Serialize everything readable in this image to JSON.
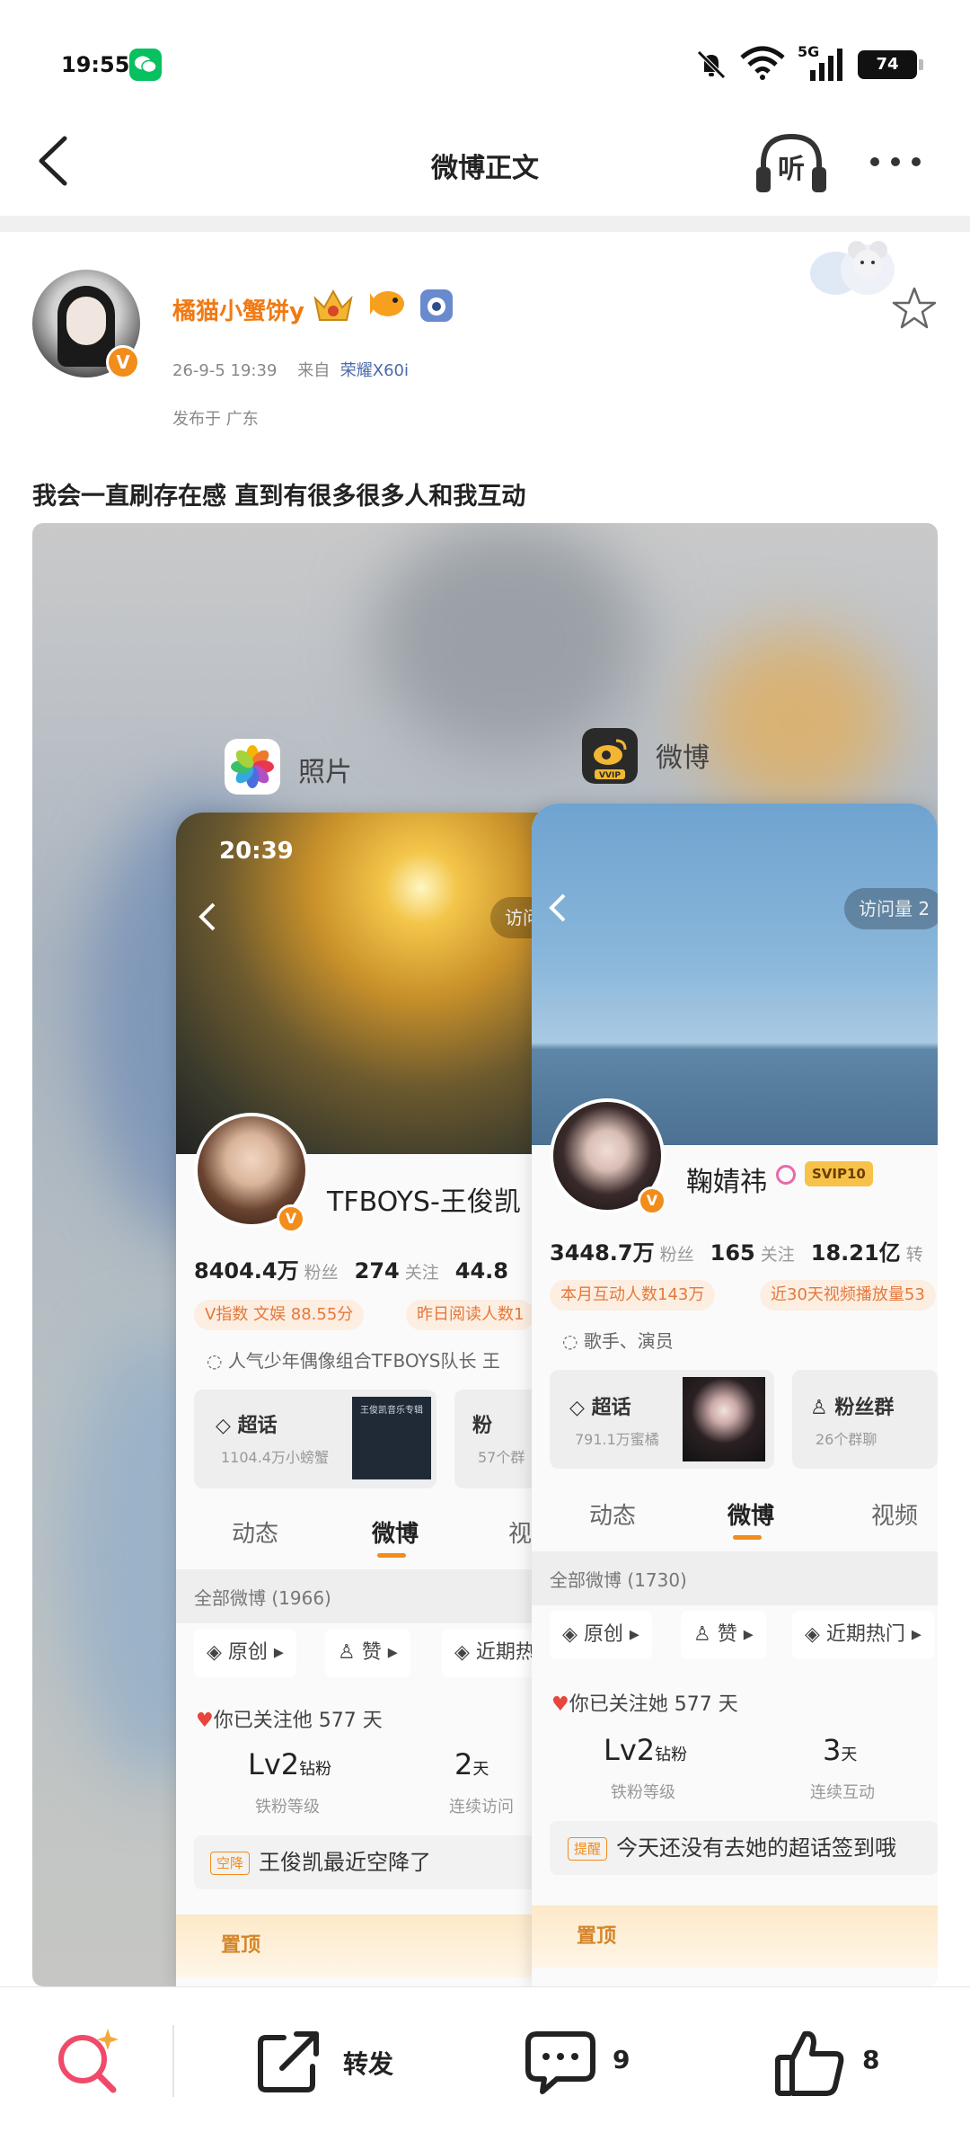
{
  "status_bar": {
    "time": "19:55",
    "network": "5G",
    "battery": "74"
  },
  "nav": {
    "title": "微博正文",
    "listen_label": "听"
  },
  "post": {
    "username": "橘猫小蟹饼y",
    "verified": "V",
    "timestamp": "26-9-5 19:39",
    "source_prefix": "来自",
    "device": "荣耀X60i",
    "location": "发布于 广东",
    "text": "我会一直刷存在感 直到有很多很多人和我互动"
  },
  "image": {
    "apps": [
      {
        "label": "照片"
      },
      {
        "label": "微博",
        "icon_badge": "VVIP"
      }
    ],
    "left_card": {
      "time": "20:39",
      "visit": "访问量",
      "name": "TFBOYS-王俊凯",
      "stats": [
        {
          "value": "8404.4万",
          "label": "粉丝"
        },
        {
          "value": "274",
          "label": "关注"
        },
        {
          "value": "44.8",
          "label": ""
        }
      ],
      "tags": [
        "V指数 文娱 88.55分",
        "昨日阅读人数1"
      ],
      "desc": "人气少年偶像组合TFBOYS队长 王",
      "box1_title": "超话",
      "box1_sub": "1104.4万小螃蟹",
      "box2_title": "粉",
      "box2_sub": "57个群",
      "album_caption": "王俊凯音乐专辑",
      "tabs": [
        "动态",
        "微博",
        "视"
      ],
      "all_count": "全部微博 (1966)",
      "filters": [
        "原创",
        "赞",
        "近期热"
      ],
      "follow": "你已关注他 577 天",
      "level_value": "Lv2",
      "level_unit": "钻粉",
      "level_label": "铁粉等级",
      "days_value": "2",
      "days_unit": "天",
      "days_label": "连续访问",
      "notice_tag": "空降",
      "notice": "王俊凯最近空降了",
      "pinned": "置顶"
    },
    "right_card": {
      "visit": "访问量 2",
      "name": "鞠婧祎",
      "svip": "SVIP10",
      "stats": [
        {
          "value": "3448.7万",
          "label": "粉丝"
        },
        {
          "value": "165",
          "label": "关注"
        },
        {
          "value": "18.21亿",
          "label": "转"
        }
      ],
      "tags": [
        "本月互动人数143万",
        "近30天视频播放量53"
      ],
      "desc": "歌手、演员",
      "box1_title": "超话",
      "box1_sub": "791.1万蜜橘",
      "box2_title": "粉丝群",
      "box2_sub": "26个群聊",
      "tabs": [
        "动态",
        "微博",
        "视频"
      ],
      "all_count": "全部微博 (1730)",
      "filters": [
        "原创",
        "赞",
        "近期热门"
      ],
      "follow": "你已关注她 577 天",
      "level_value": "Lv2",
      "level_unit": "钻粉",
      "level_label": "铁粉等级",
      "days_value": "3",
      "days_unit": "天",
      "days_label": "连续互动",
      "notice_tag": "提醒",
      "notice": "今天还没有去她的超话签到哦",
      "pinned": "置顶"
    }
  },
  "bottom_bar": {
    "repost_label": "转发",
    "comment_count": "9",
    "like_count": "8"
  },
  "colors": {
    "accent": "#f07a14",
    "link": "#4a6aa8",
    "wechat": "#07c160"
  }
}
